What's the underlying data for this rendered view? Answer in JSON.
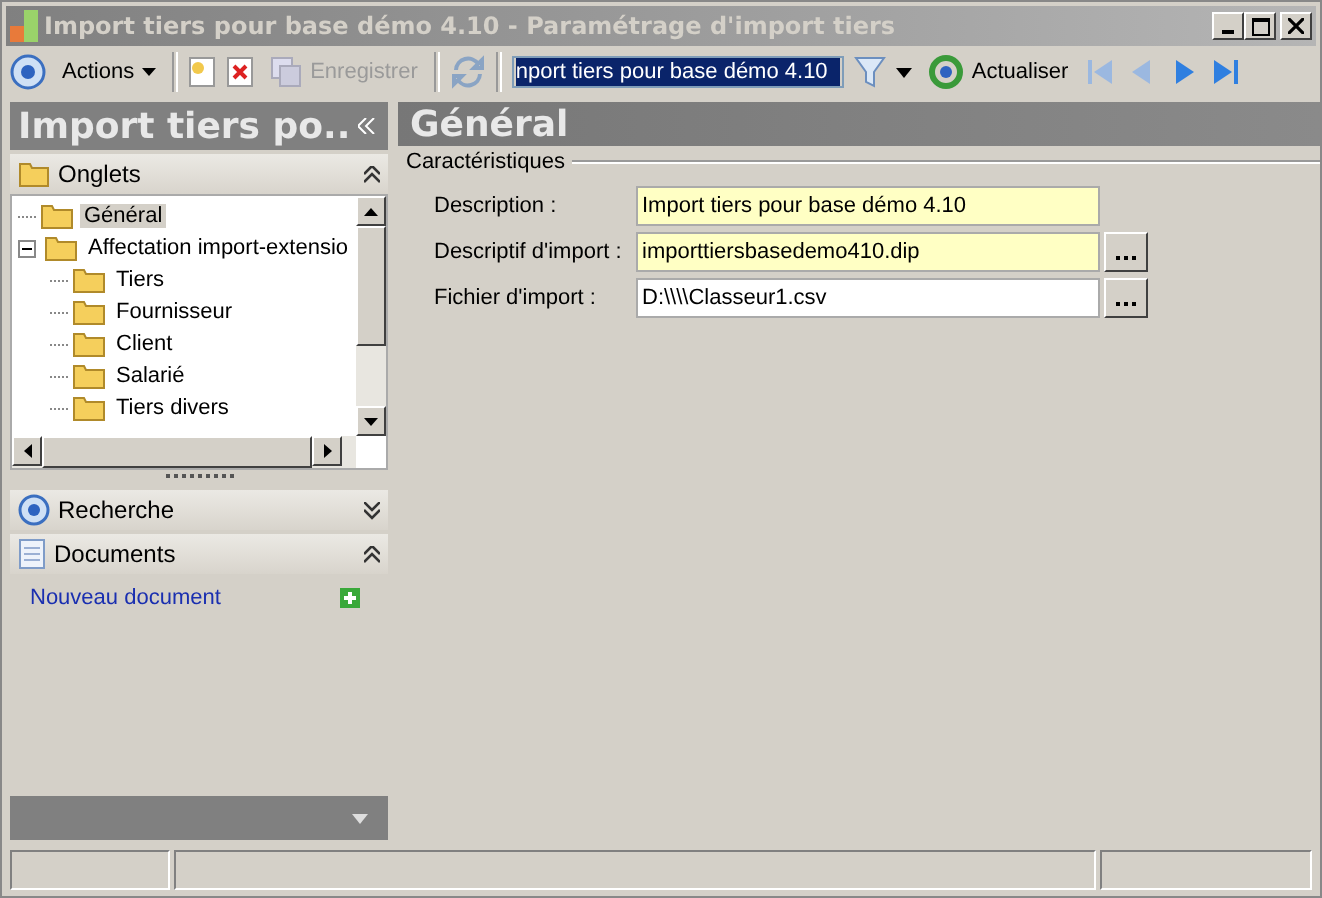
{
  "window": {
    "title": "Import tiers pour base démo 4.10 -  Paramétrage d'import tiers"
  },
  "toolbar": {
    "actions": "Actions",
    "save": "Enregistrer",
    "save_disabled": true,
    "search_value": "nport tiers pour base démo 4.10",
    "refresh": "Actualiser"
  },
  "sidebar": {
    "title": "Import tiers po..",
    "tabs_section": {
      "label": "Onglets",
      "expanded": true
    },
    "tree": [
      {
        "label": "Général",
        "selected": true
      },
      {
        "label": "Affectation import-extensio",
        "selected": false,
        "expanded": true,
        "children": [
          {
            "label": "Tiers",
            "selected": false
          },
          {
            "label": "Fournisseur",
            "selected": false
          },
          {
            "label": "Client",
            "selected": false
          },
          {
            "label": "Salarié",
            "selected": false
          },
          {
            "label": "Tiers divers",
            "selected": false
          }
        ]
      }
    ],
    "search_section": {
      "label": "Recherche",
      "expanded": false
    },
    "documents_section": {
      "label": "Documents",
      "expanded": true
    },
    "new_document": "Nouveau document"
  },
  "content": {
    "title": "Général",
    "group": "Caractéristiques",
    "fields": [
      {
        "label": "Description :",
        "value": "Import tiers pour base démo 4.10",
        "required": true,
        "browse": false
      },
      {
        "label": "Descriptif d'import :",
        "value": "importtiersbasedemo410.dip",
        "required": true,
        "browse": true
      },
      {
        "label": "Fichier d'import :",
        "value": "D:\\\\\\\\Classeur1.csv",
        "required": false,
        "browse": true
      }
    ]
  }
}
